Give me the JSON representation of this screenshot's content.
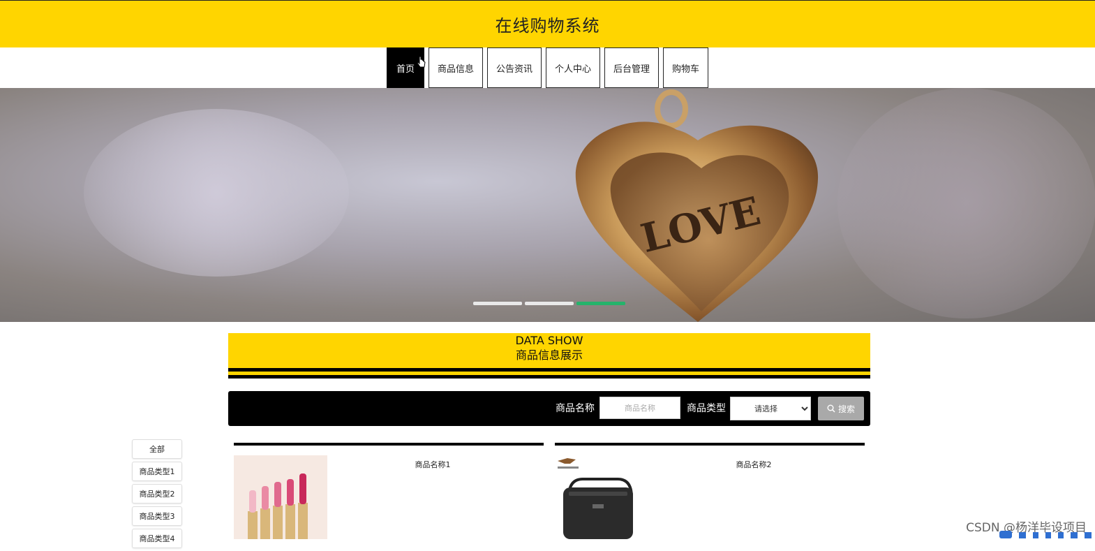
{
  "header": {
    "title": "在线购物系统"
  },
  "nav": {
    "items": [
      {
        "label": "首页",
        "active": true
      },
      {
        "label": "商品信息"
      },
      {
        "label": "公告资讯"
      },
      {
        "label": "个人中心"
      },
      {
        "label": "后台管理"
      },
      {
        "label": "购物车"
      }
    ]
  },
  "banner": {
    "text": "LOVE",
    "dots": 3,
    "active_dot": 3
  },
  "section": {
    "title_en": "DATA SHOW",
    "title_cn": "商品信息展示"
  },
  "search": {
    "name_label": "商品名称",
    "name_placeholder": "商品名称",
    "type_label": "商品类型",
    "type_selected": "请选择",
    "button_label": "搜索"
  },
  "categories": [
    "全部",
    "商品类型1",
    "商品类型2",
    "商品类型3",
    "商品类型4"
  ],
  "products": [
    {
      "name": "商品名称1",
      "image": "lipstick-set"
    },
    {
      "name": "商品名称2",
      "image": "shoulder-bag"
    }
  ],
  "watermark": "CSDN @杨洋毕设项目",
  "colors": {
    "brand_yellow": "#ffd500",
    "black": "#000000",
    "active_dot": "#25b36b"
  }
}
